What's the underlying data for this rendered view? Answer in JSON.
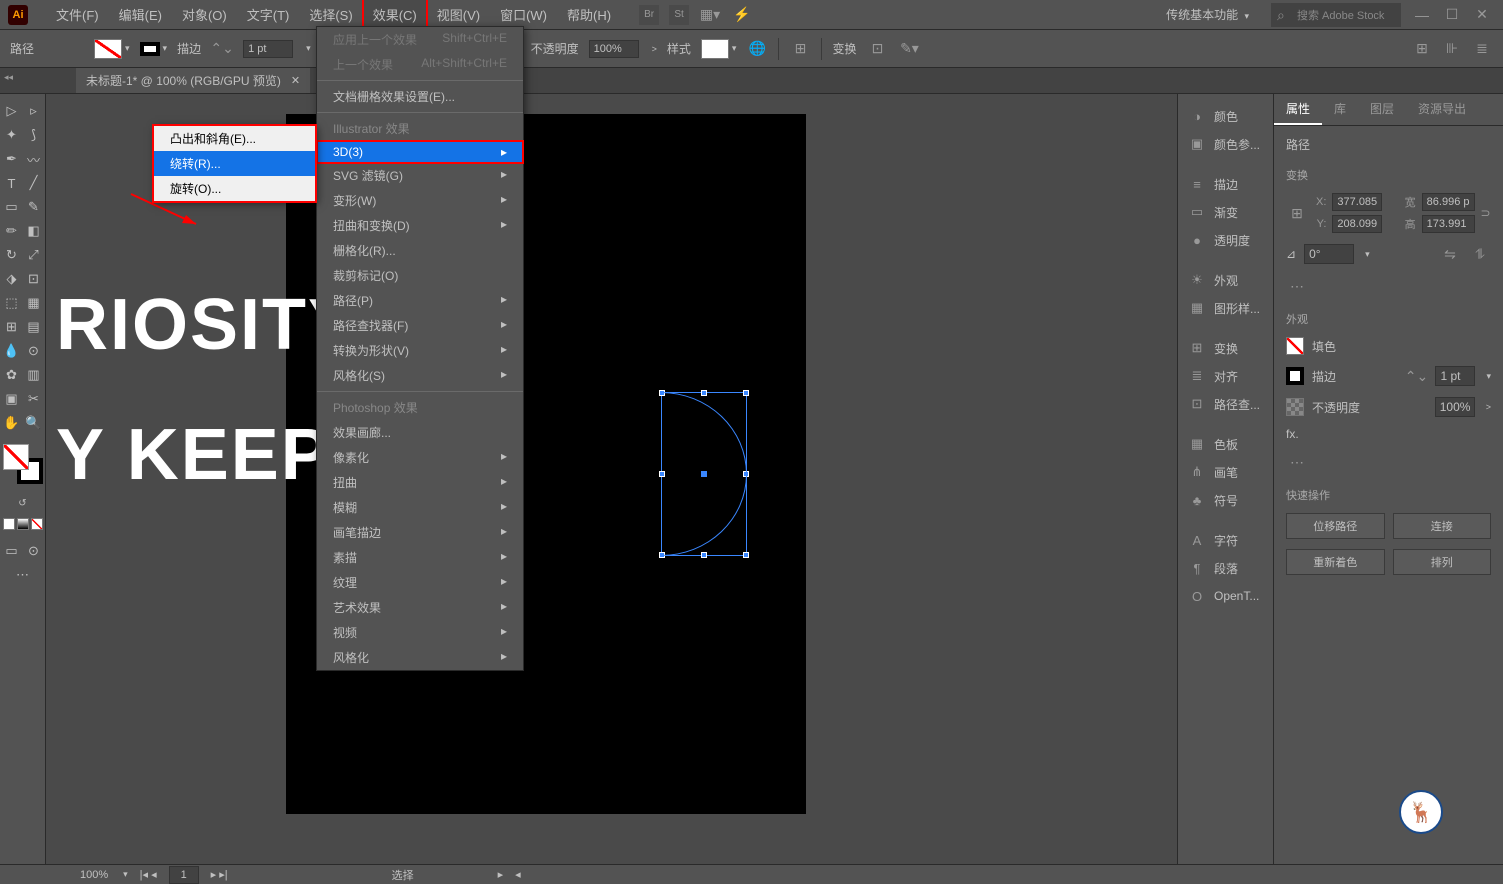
{
  "menubar": {
    "items": [
      "文件(F)",
      "编辑(E)",
      "对象(O)",
      "文字(T)",
      "选择(S)",
      "效果(C)",
      "视图(V)",
      "窗口(W)",
      "帮助(H)"
    ],
    "active_index": 5,
    "workspace": "传统基本功能",
    "search_placeholder": "搜索 Adobe Stock"
  },
  "controlbar": {
    "label": "路径",
    "stroke_label": "描边",
    "stroke_val": "1 pt",
    "opacity_label": "不透明度",
    "opacity_val": "100%",
    "style_label": "样式",
    "transform_label": "变换"
  },
  "doc_tab": "未标题-1* @ 100% (RGB/GPU 预览)",
  "effects_menu": {
    "top": [
      {
        "label": "应用上一个效果",
        "shortcut": "Shift+Ctrl+E",
        "disabled": true
      },
      {
        "label": "上一个效果",
        "shortcut": "Alt+Shift+Ctrl+E",
        "disabled": true
      }
    ],
    "docraster": "文档栅格效果设置(E)...",
    "header1": "Illustrator 效果",
    "group1": [
      "3D(3)",
      "SVG 滤镜(G)",
      "变形(W)",
      "扭曲和变换(D)",
      "栅格化(R)...",
      "裁剪标记(O)",
      "路径(P)",
      "路径查找器(F)",
      "转换为形状(V)",
      "风格化(S)"
    ],
    "header2": "Photoshop 效果",
    "group2": [
      "效果画廊...",
      "像素化",
      "扭曲",
      "模糊",
      "画笔描边",
      "素描",
      "纹理",
      "艺术效果",
      "视频",
      "风格化"
    ]
  },
  "submenu_3d": [
    "凸出和斜角(E)...",
    "绕转(R)...",
    "旋转(O)..."
  ],
  "canvas": {
    "bgtext1": "RIOSITY",
    "bgtext2": "Y KEEP"
  },
  "rpanel": [
    {
      "icon": "◑",
      "label": "颜色"
    },
    {
      "icon": "▣",
      "label": "颜色参..."
    },
    {
      "icon": "≡",
      "label": "描边"
    },
    {
      "icon": "▭",
      "label": "渐变"
    },
    {
      "icon": "●",
      "label": "透明度"
    },
    {
      "icon": "☀",
      "label": "外观"
    },
    {
      "icon": "▦",
      "label": "图形样..."
    },
    {
      "icon": "⊞",
      "label": "变换"
    },
    {
      "icon": "≣",
      "label": "对齐"
    },
    {
      "icon": "⊡",
      "label": "路径查..."
    },
    {
      "icon": "▦",
      "label": "色板"
    },
    {
      "icon": "⋔",
      "label": "画笔"
    },
    {
      "icon": "♣",
      "label": "符号"
    },
    {
      "icon": "A",
      "label": "字符"
    },
    {
      "icon": "¶",
      "label": "段落"
    },
    {
      "icon": "O",
      "label": "OpenT..."
    }
  ],
  "props": {
    "tabs": [
      "属性",
      "库",
      "图层",
      "资源导出"
    ],
    "type": "路径",
    "transform_title": "变换",
    "x": "377.085",
    "w_label": "宽",
    "w": "86.996 p",
    "y": "208.099",
    "h_label": "高",
    "h": "173.991",
    "angle_label": "⊿",
    "angle": "0°",
    "appearance_title": "外观",
    "fill_label": "填色",
    "stroke_label": "描边",
    "stroke_val": "1 pt",
    "opacity_label": "不透明度",
    "opacity_val": "100%",
    "fx_label": "fx.",
    "quick_title": "快速操作",
    "btns": [
      "位移路径",
      "连接",
      "重新着色",
      "排列"
    ]
  },
  "statusbar": {
    "zoom": "100%",
    "page": "1",
    "mode": "选择"
  }
}
